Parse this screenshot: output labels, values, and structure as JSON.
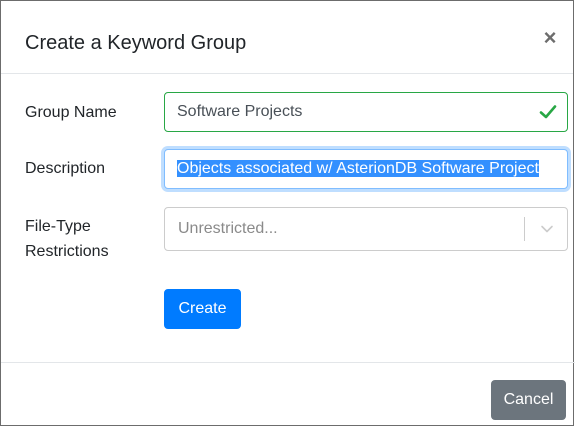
{
  "modal": {
    "title": "Create a Keyword Group",
    "close_label": "×"
  },
  "form": {
    "group_name": {
      "label": "Group Name",
      "value": "Software Projects",
      "state": "valid"
    },
    "description": {
      "label": "Description",
      "value": "Objects associated w/ AsterionDB Software Project",
      "state": "focused-selected"
    },
    "file_type": {
      "label_line1": "File-Type",
      "label_line2": "Restrictions",
      "placeholder": "Unrestricted..."
    },
    "create_label": "Create"
  },
  "footer": {
    "cancel_label": "Cancel"
  },
  "colors": {
    "primary": "#007bff",
    "secondary": "#6c757d",
    "valid": "#28a745",
    "selection": "#3390ff"
  },
  "icons": {
    "close": "close-icon",
    "valid": "check-icon",
    "dropdown": "chevron-down-icon"
  }
}
